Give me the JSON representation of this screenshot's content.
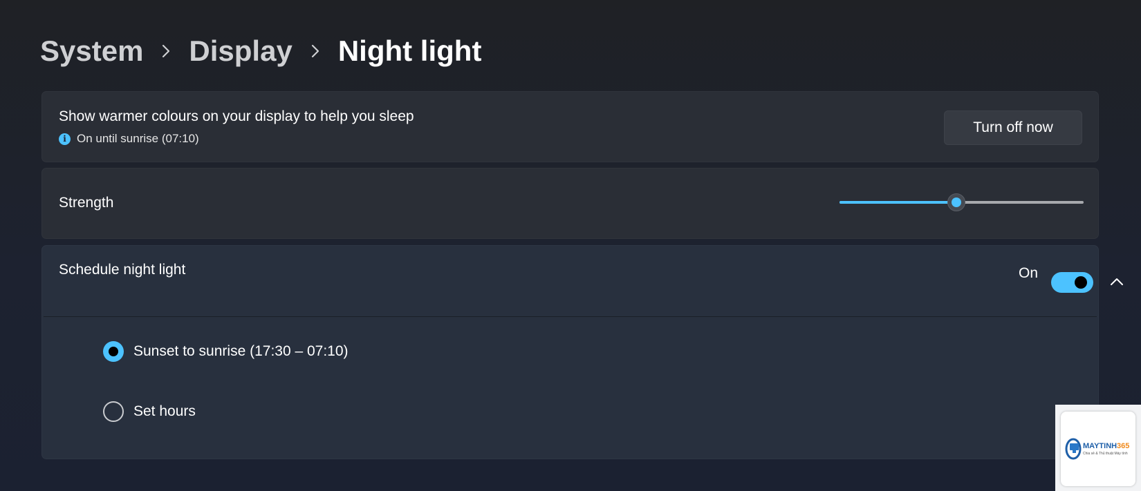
{
  "breadcrumb": {
    "items": [
      {
        "label": "System"
      },
      {
        "label": "Display"
      },
      {
        "label": "Night light"
      }
    ]
  },
  "info_card": {
    "title": "Show warmer colours on your display to help you sleep",
    "status": "On until sunrise (07:10)",
    "status_icon": "info-icon",
    "button_label": "Turn off now"
  },
  "strength": {
    "label": "Strength",
    "value_fraction": 0.48
  },
  "schedule": {
    "label": "Schedule night light",
    "toggle_state_label": "On",
    "toggle_on": true,
    "expanded": true,
    "options": [
      {
        "label": "Sunset to sunrise (17:30 – 07:10)",
        "checked": true
      },
      {
        "label": "Set hours",
        "checked": false
      }
    ]
  },
  "colors": {
    "accent": "#4cc2ff",
    "card_background": "#2a2e36",
    "page_background": "#1d2230"
  },
  "watermark": {
    "brand": "MAYTINH365",
    "tagline": "Chia sẻ & Thủ thuật Máy tính"
  }
}
